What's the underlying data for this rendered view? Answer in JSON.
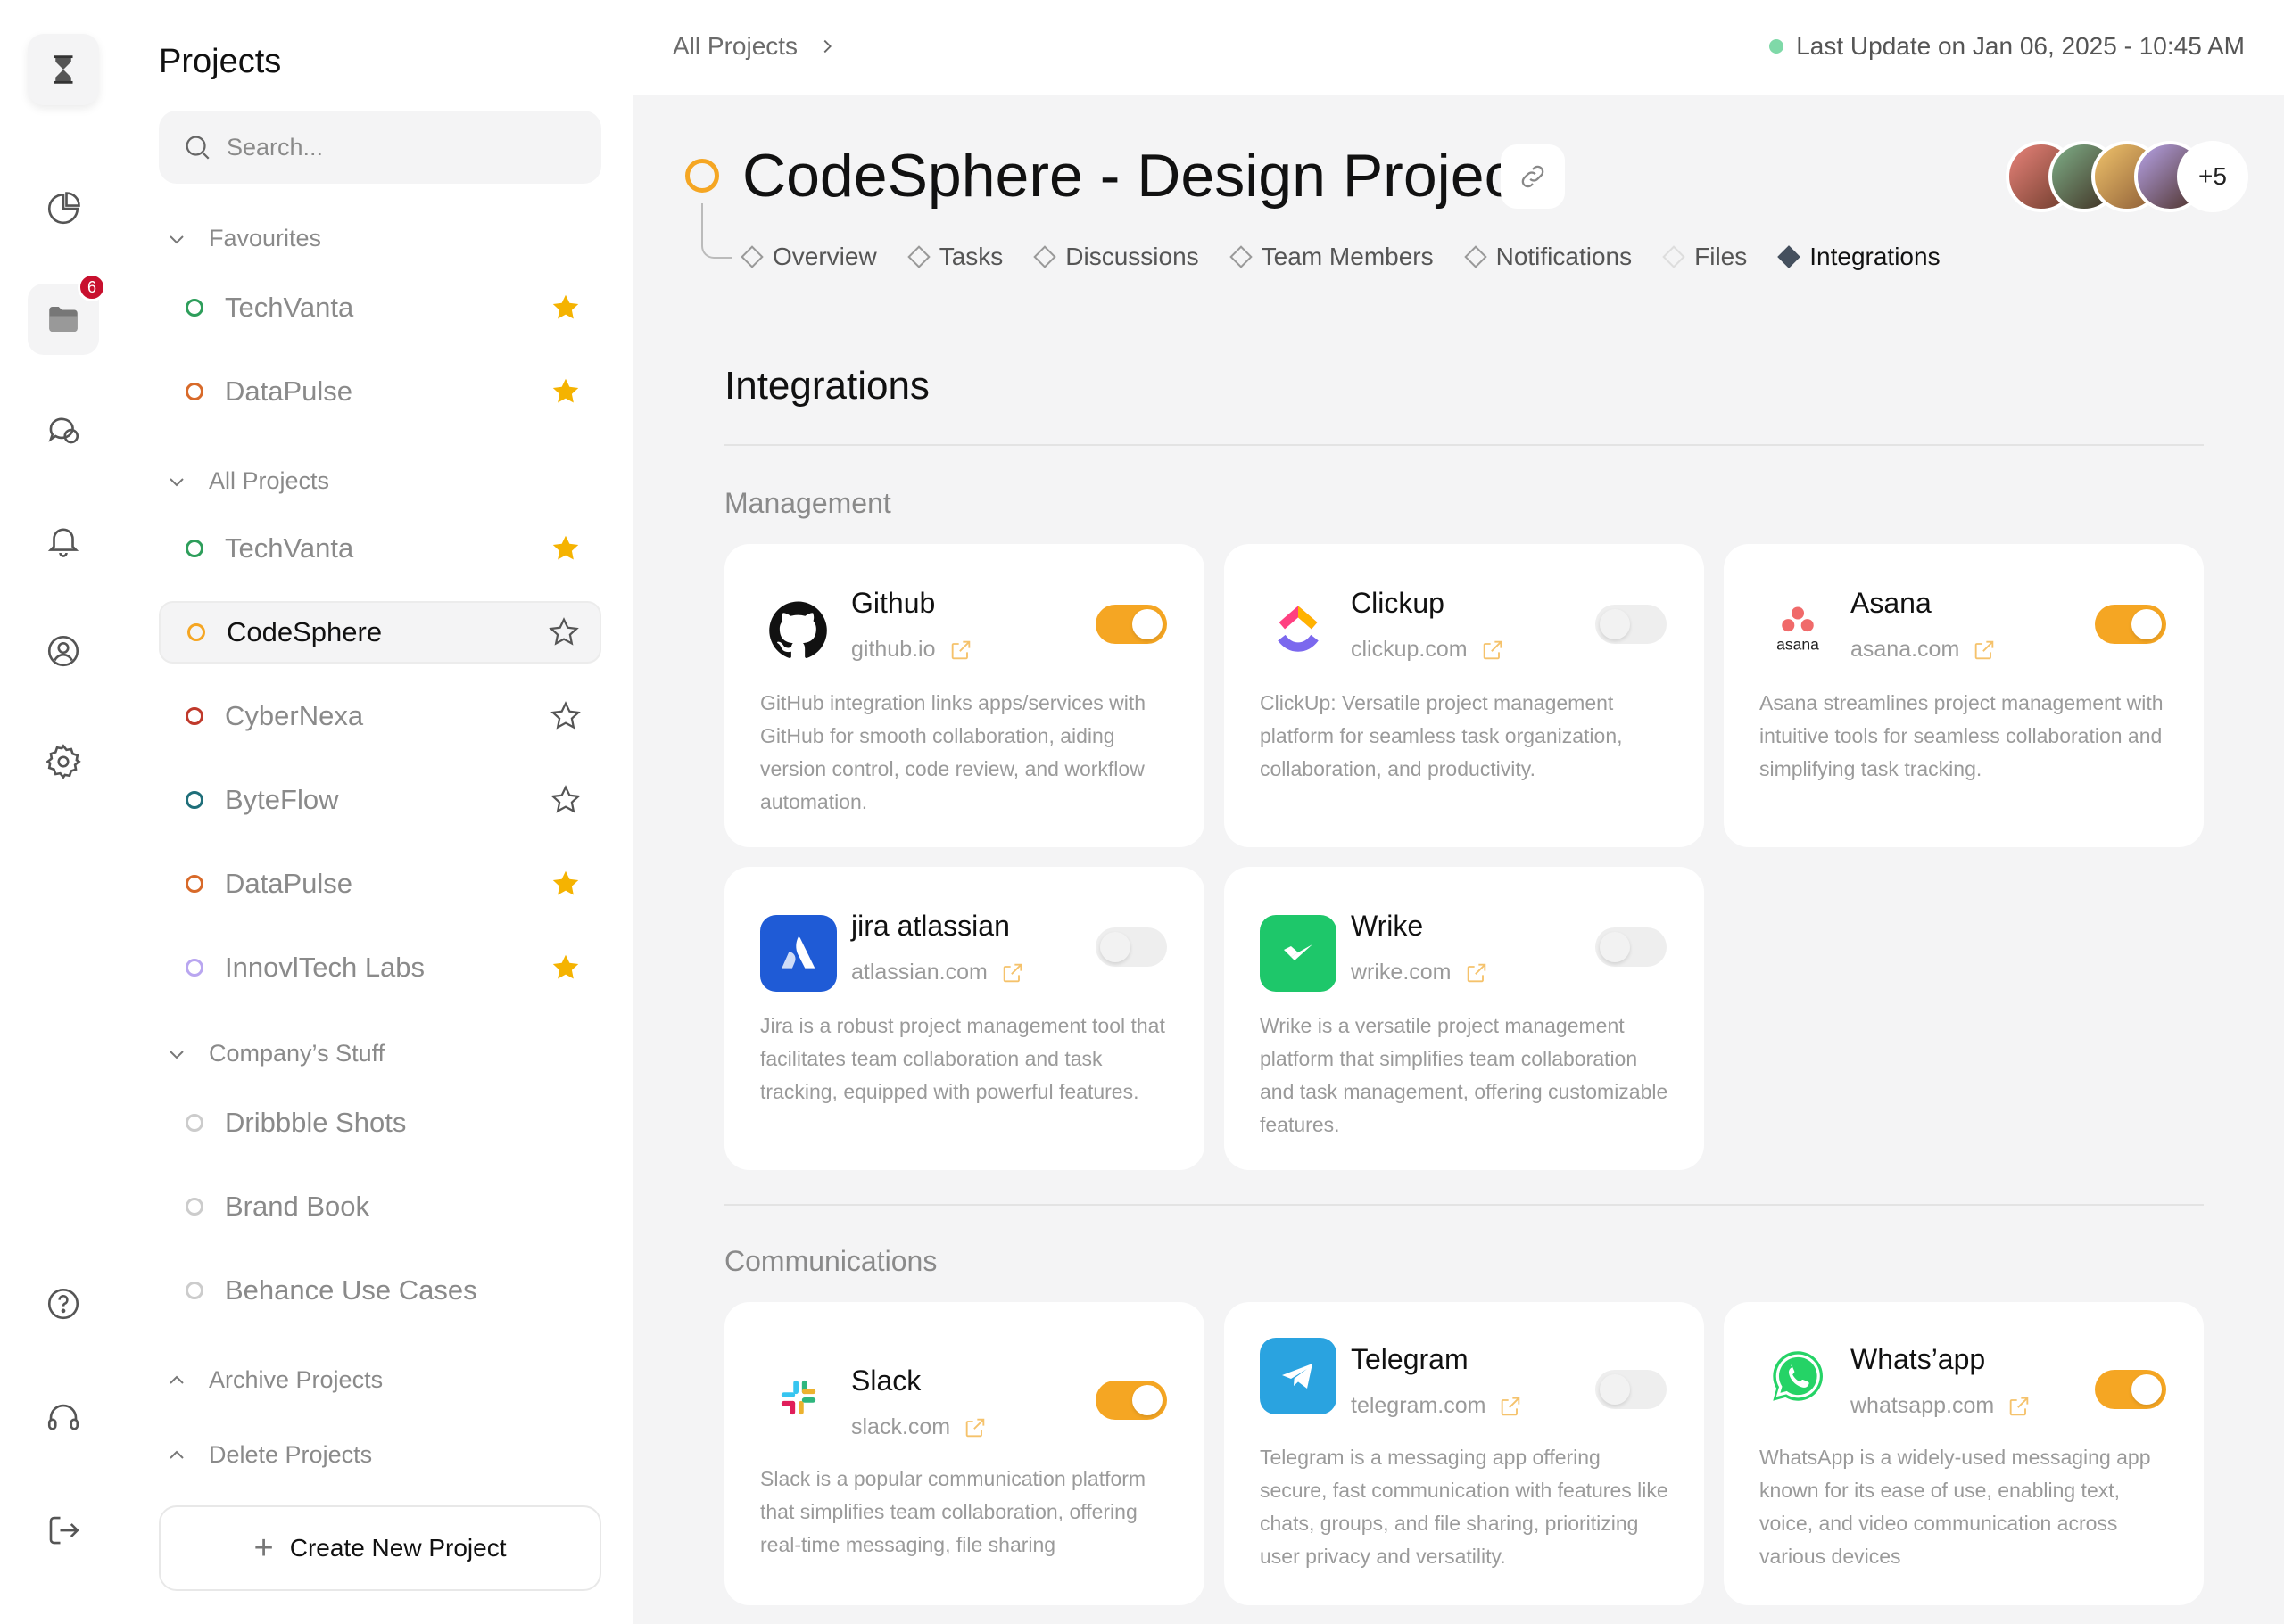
{
  "rail": {
    "badge_count": "6"
  },
  "sidebar": {
    "title": "Projects",
    "search_placeholder": "Search...",
    "sections": {
      "favourites": "Favourites",
      "all_projects": "All Projects",
      "company": "Company’s Stuff",
      "archive": "Archive Projects",
      "delete": "Delete Projects"
    },
    "favourites": [
      {
        "name": "TechVanta",
        "color": "#2e9e5b",
        "starred": true
      },
      {
        "name": "DataPulse",
        "color": "#d86a2a",
        "starred": true
      }
    ],
    "all_projects": [
      {
        "name": "TechVanta",
        "color": "#2e9e5b",
        "starred": true
      },
      {
        "name": "CodeSphere",
        "color": "#f5a623",
        "starred": false,
        "active": true
      },
      {
        "name": "CyberNexa",
        "color": "#c0392b",
        "starred": false
      },
      {
        "name": "ByteFlow",
        "color": "#1f6f7a",
        "starred": false
      },
      {
        "name": "DataPulse",
        "color": "#d86a2a",
        "starred": true
      },
      {
        "name": "InnovlTech Labs",
        "color": "#b9a6f0",
        "starred": true
      }
    ],
    "company": [
      {
        "name": "Dribbble Shots",
        "color": "#cccccc"
      },
      {
        "name": "Brand Book",
        "color": "#cccccc"
      },
      {
        "name": "Behance Use Cases",
        "color": "#cccccc"
      }
    ],
    "create_label": "Create New Project"
  },
  "topbar": {
    "breadcrumb": "All Projects",
    "last_update": "Last Update on Jan 06, 2025 - 10:45 AM"
  },
  "project": {
    "title": "CodeSphere - Design Project",
    "members_more": "+5",
    "tabs": [
      "Overview",
      "Tasks",
      "Discussions",
      "Team Members",
      "Notifications",
      "Files",
      "Integrations"
    ],
    "active_tab": "Integrations"
  },
  "integrations": {
    "title": "Integrations",
    "groups": {
      "management": "Management",
      "communications": "Communications"
    },
    "cards": {
      "github": {
        "name": "Github",
        "url": "github.io",
        "enabled": true,
        "desc": "GitHub integration links apps/services with GitHub for smooth collaboration, aiding version control, code review, and workflow automation."
      },
      "clickup": {
        "name": "Clickup",
        "url": "clickup.com",
        "enabled": false,
        "desc": "ClickUp: Versatile project management platform for seamless task organization, collaboration, and productivity."
      },
      "asana": {
        "name": "Asana",
        "url": "asana.com",
        "enabled": true,
        "logo_text": "asana",
        "desc": "Asana streamlines project management with intuitive tools for seamless collaboration and simplifying task tracking."
      },
      "jira": {
        "name": "jira atlassian",
        "url": "atlassian.com",
        "enabled": false,
        "desc": "Jira is a robust project management tool that facilitates team collaboration and task tracking, equipped with powerful features."
      },
      "wrike": {
        "name": "Wrike",
        "url": "wrike.com",
        "enabled": false,
        "desc": "Wrike is a versatile project management platform that simplifies team collaboration and task management, offering customizable features."
      },
      "slack": {
        "name": "Slack",
        "url": "slack.com",
        "enabled": true,
        "desc": "Slack is a popular communication platform that simplifies team collaboration, offering real-time messaging, file sharing"
      },
      "telegram": {
        "name": "Telegram",
        "url": "telegram.com",
        "enabled": false,
        "desc": "Telegram is a messaging app offering secure, fast communication with features like chats, groups, and file sharing, prioritizing user privacy and versatility."
      },
      "whatsapp": {
        "name": "Whats’app",
        "url": "whatsapp.com",
        "enabled": true,
        "desc": "WhatsApp is a widely-used messaging app known for its ease of use, enabling text, voice, and video communication across various devices"
      }
    }
  },
  "colors": {
    "accent": "#f5a623",
    "bg": "#f4f4f5",
    "live": "#7fd9a8",
    "badge": "#c8102e"
  }
}
